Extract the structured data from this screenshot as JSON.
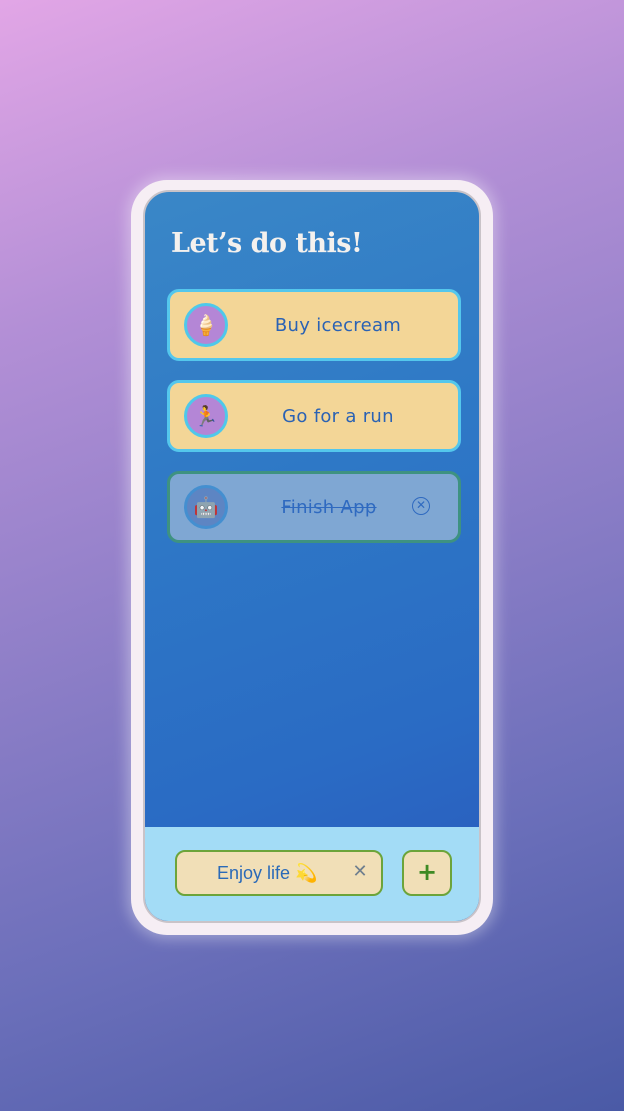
{
  "header": {
    "title": "Let’s do this!"
  },
  "todos": [
    {
      "label": "Buy icecream",
      "icon": "ice-cream-icon",
      "glyph": "🍦",
      "completed": false
    },
    {
      "label": "Go for a run",
      "icon": "runner-icon",
      "glyph": "🏃",
      "completed": false
    },
    {
      "label": "Finish App",
      "icon": "robot-icon",
      "glyph": "🤖",
      "completed": true,
      "remove_icon": "circle-x-icon",
      "remove_glyph": "✕"
    }
  ],
  "new_task": {
    "value": "Enjoy life 💫",
    "clear_glyph": "✕",
    "add_glyph": "+"
  },
  "colors": {
    "task_card": "#f3d697",
    "task_border": "#54c7ec",
    "completed_card": "#7fa7d3",
    "completed_border": "#3e9281",
    "footer": "#a3dcf6",
    "accent_green": "#6ca43a",
    "text_blue": "#2a62b4"
  }
}
